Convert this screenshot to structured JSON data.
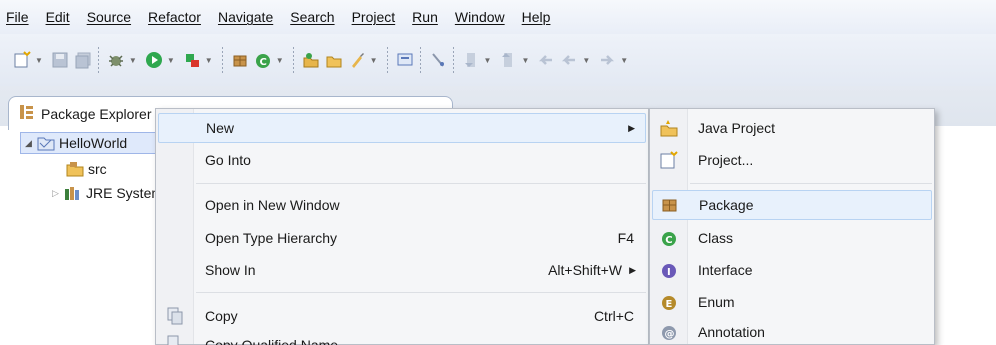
{
  "menubar": {
    "items": [
      "File",
      "Edit",
      "Source",
      "Refactor",
      "Navigate",
      "Search",
      "Project",
      "Run",
      "Window",
      "Help"
    ]
  },
  "explorer": {
    "tab_label": "Package Explorer",
    "close_glyph": "⊠",
    "tree": {
      "project": "HelloWorld",
      "src": "src",
      "jre": "JRE System Library"
    }
  },
  "context_menu": {
    "new": "New",
    "go_into": "Go Into",
    "open_new_window": "Open in New Window",
    "open_type_hierarchy": "Open Type Hierarchy",
    "open_type_hierarchy_accel": "F4",
    "show_in": "Show In",
    "show_in_accel": "Alt+Shift+W",
    "copy": "Copy",
    "copy_accel": "Ctrl+C",
    "copy_qualified": "Copy Qualified Name"
  },
  "submenu": {
    "items": [
      "Java Project",
      "Project...",
      "Package",
      "Class",
      "Interface",
      "Enum",
      "Annotation"
    ]
  },
  "colors": {
    "menu_bg": "#f5f6f8",
    "hover_bg": "#e8f1fc",
    "hover_border": "#b8d3f2",
    "toolbar_bg": "#e3e9f3"
  }
}
